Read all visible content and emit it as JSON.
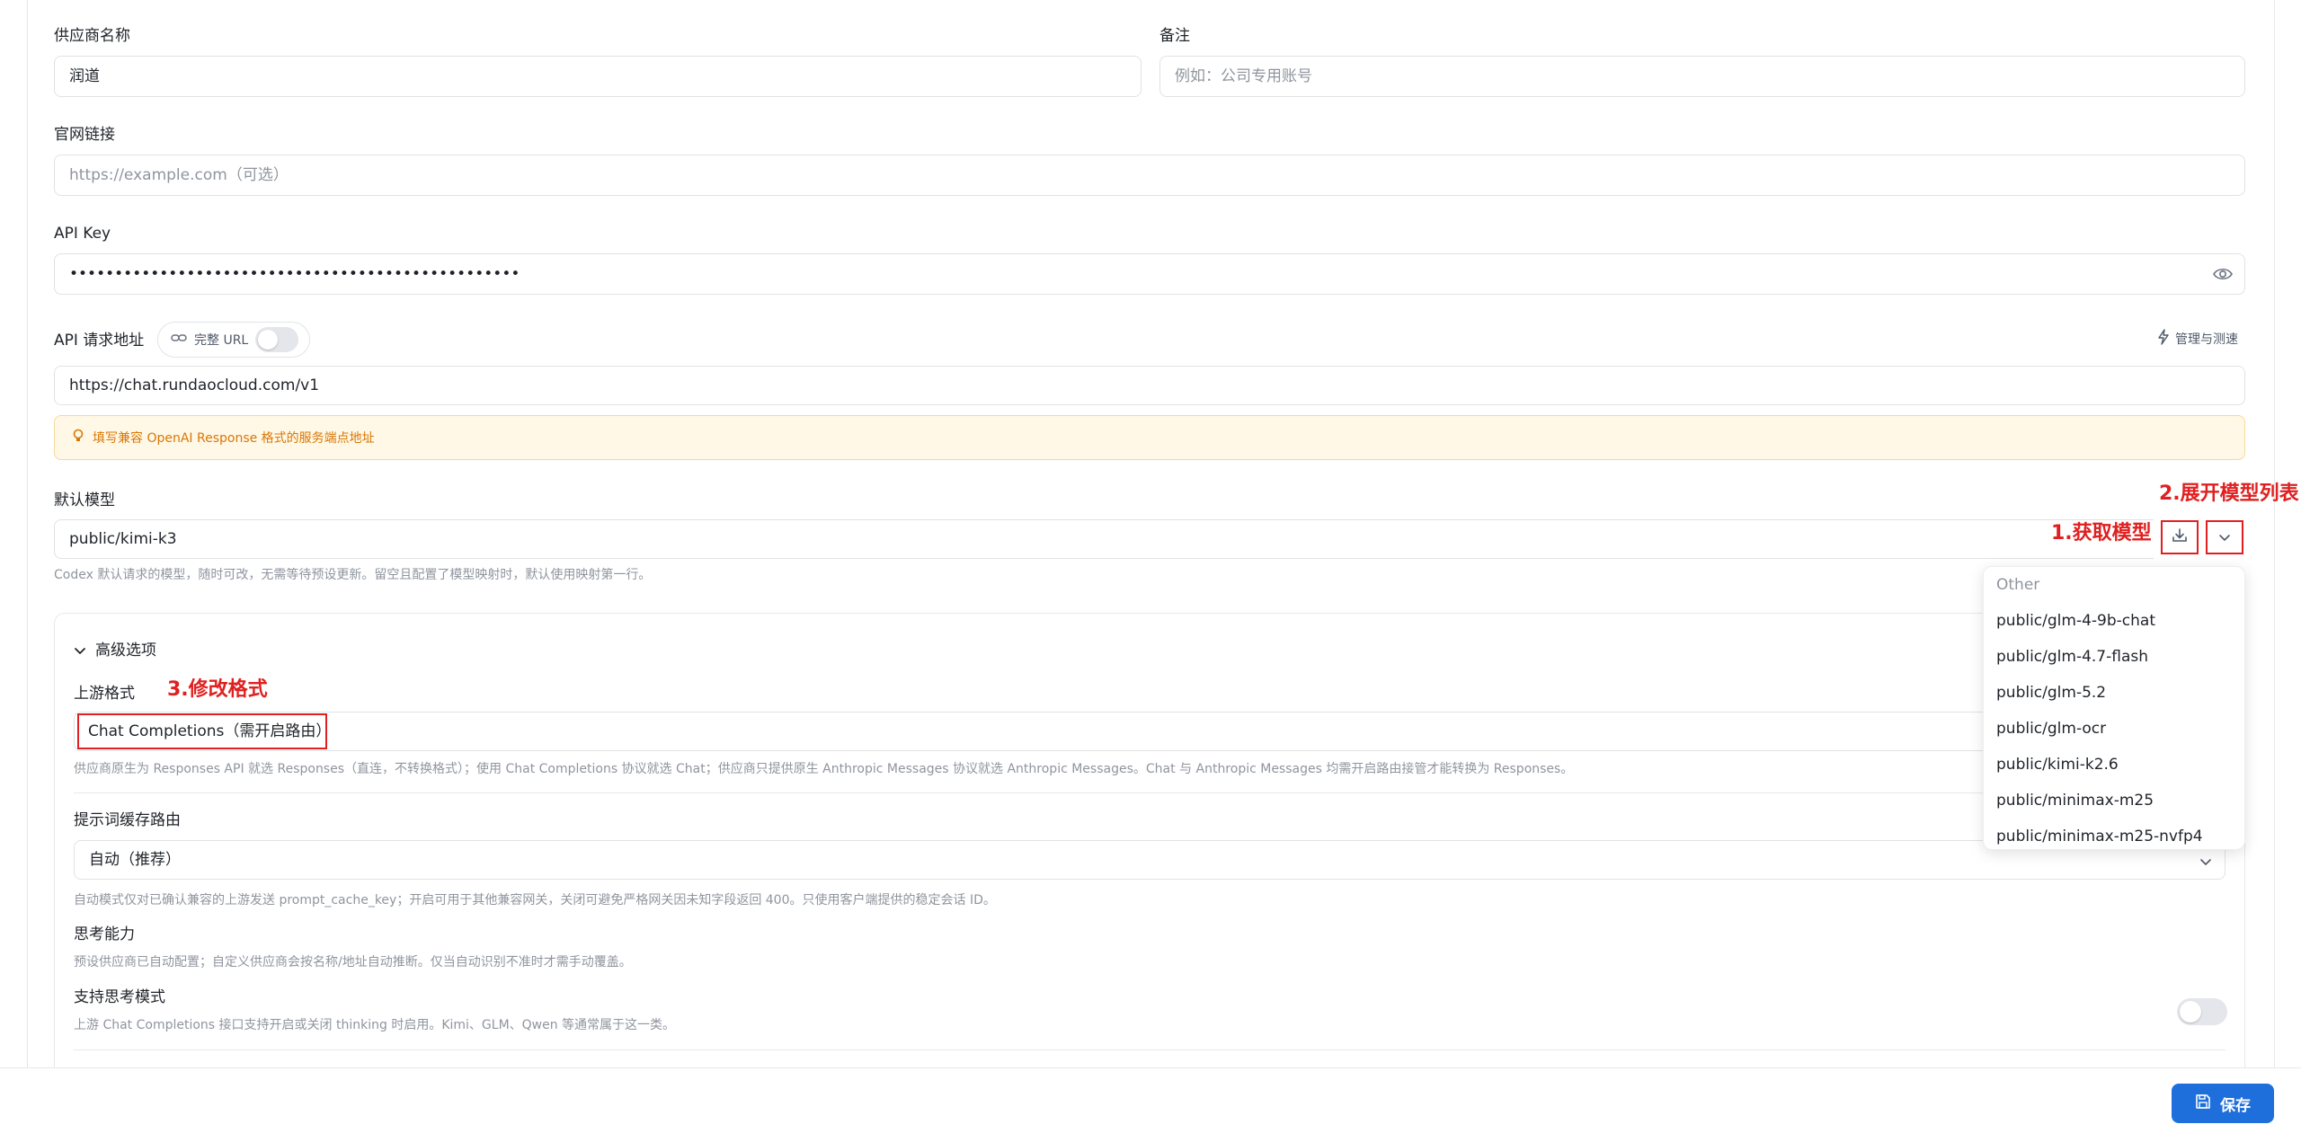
{
  "form": {
    "provider_name_label": "供应商名称",
    "provider_name_value": "润道",
    "note_label": "备注",
    "note_placeholder": "例如：公司专用账号",
    "website_label": "官网链接",
    "website_placeholder": "https://example.com（可选）",
    "api_key_label": "API Key",
    "api_key_value": "••••••••••••••••••••••••••••••••••••••••••••••••••",
    "endpoint_label": "API 请求地址",
    "full_url_label": "完整 URL",
    "full_url_enabled": false,
    "manage_label": "管理与测速",
    "endpoint_value": "https://chat.rundaocloud.com/v1",
    "endpoint_tip": "填写兼容 OpenAI Response 格式的服务端点地址",
    "default_model_label": "默认模型",
    "default_model_value": "public/kimi-k3",
    "default_model_hint": "Codex 默认请求的模型，随时可改，无需等待预设更新。留空且配置了模型映射时，默认使用映射第一行。"
  },
  "annotations": {
    "fetch_models": "1.获取模型",
    "expand_list": "2.展开模型列表",
    "change_format": "3.修改格式"
  },
  "model_dropdown": {
    "group": "Other",
    "options": [
      "public/glm-4-9b-chat",
      "public/glm-4.7-flash",
      "public/glm-5.2",
      "public/glm-ocr",
      "public/kimi-k2.6",
      "public/minimax-m25",
      "public/minimax-m25-nvfp4"
    ]
  },
  "advanced": {
    "title": "高级选项",
    "upstream_format_label": "上游格式",
    "upstream_format_value": "Chat Completions（需开启路由）",
    "upstream_format_hint": "供应商原生为 Responses API 就选 Responses（直连，不转换格式）；使用 Chat Completions 协议就选 Chat；供应商只提供原生 Anthropic Messages 协议就选 Anthropic Messages。Chat 与 Anthropic Messages 均需开启路由接管才能转换为 Responses。",
    "cache_route_label": "提示词缓存路由",
    "cache_route_value": "自动（推荐）",
    "cache_route_hint": "自动模式仅对已确认兼容的上游发送 prompt_cache_key；开启可用于其他兼容网关，关闭可避免严格网关因未知字段返回 400。只使用客户端提供的稳定会话 ID。",
    "thinking_label": "思考能力",
    "thinking_hint": "预设供应商已自动配置；自定义供应商会按名称/地址自动推断。仅当自动识别不准时才需手动覆盖。",
    "support_thinking_label": "支持思考模式",
    "support_thinking_hint": "上游 Chat Completions 接口支持开启或关闭 thinking 时启用。Kimi、GLM、Qwen 等通常属于这一类。",
    "support_thinking_enabled": false
  },
  "footer": {
    "save_label": "保存"
  },
  "colors": {
    "accent": "#1e6fdc",
    "annotation": "#e02020",
    "tip_text": "#d97706",
    "tip_bg": "#fff8e6"
  }
}
